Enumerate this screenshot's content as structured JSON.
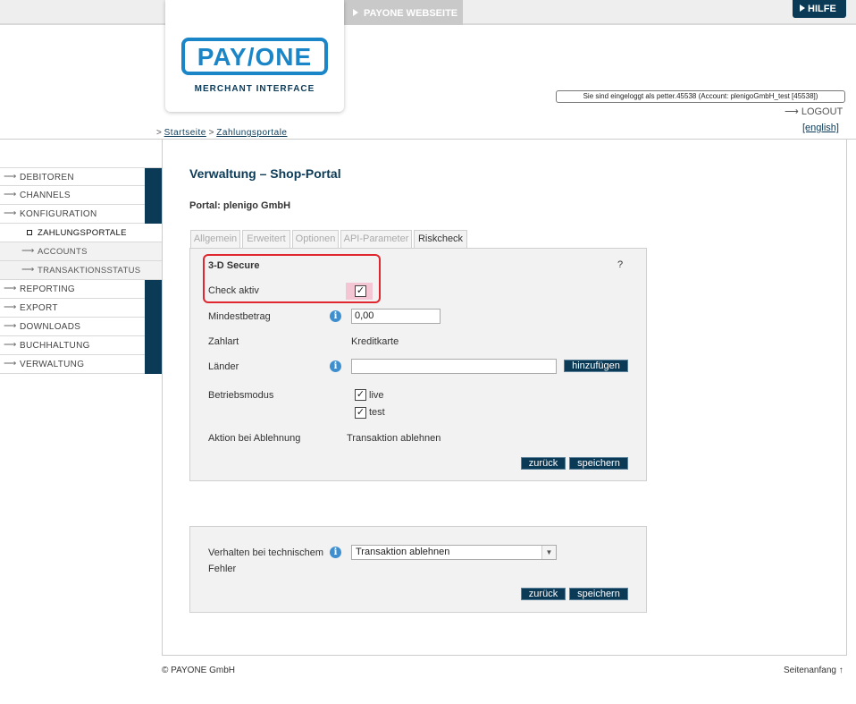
{
  "header": {
    "webseite_label": "PAYONE WEBSEITE",
    "hilfe_label": "HILFE",
    "logo_text": "PAY/ONE",
    "logo_subtitle": "MERCHANT INTERFACE",
    "login_info": "Sie sind eingeloggt als petter.45538 (Account: plenigoGmbH_test [45538])",
    "logout_label": "LOGOUT",
    "language_link": "[english]"
  },
  "breadcrumb": {
    "prefix": ">",
    "home": "Startseite",
    "separator": ">",
    "current": "Zahlungsportale"
  },
  "sidebar": {
    "items": [
      {
        "label": "DEBITOREN"
      },
      {
        "label": "CHANNELS"
      },
      {
        "label": "KONFIGURATION"
      },
      {
        "label": "ZAHLUNGSPORTALE"
      },
      {
        "label": "ACCOUNTS"
      },
      {
        "label": "TRANSAKTIONSSTATUS"
      },
      {
        "label": "REPORTING"
      },
      {
        "label": "EXPORT"
      },
      {
        "label": "DOWNLOADS"
      },
      {
        "label": "BUCHHALTUNG"
      },
      {
        "label": "VERWALTUNG"
      }
    ]
  },
  "main": {
    "title": "Verwaltung – Shop-Portal",
    "portal": "Portal: plenigo GmbH",
    "tabs": [
      {
        "label": "Allgemein"
      },
      {
        "label": "Erweitert"
      },
      {
        "label": "Optionen"
      },
      {
        "label": "API-Parameter"
      },
      {
        "label": "Riskcheck"
      }
    ],
    "section_title": "3-D Secure",
    "help_icon": "?",
    "check_aktiv_label": "Check aktiv",
    "check_aktiv_mark": "✓",
    "mindestbetrag_label": "Mindestbetrag",
    "mindestbetrag_value": "0,00",
    "zahlart_label": "Zahlart",
    "zahlart_value": "Kreditkarte",
    "laender_label": "Länder",
    "laender_value": "",
    "add_button": "hinzufügen",
    "betriebsmodus_label": "Betriebsmodus",
    "mode_live": "live",
    "mode_test": "test",
    "mode_live_mark": "✓",
    "mode_test_mark": "✓",
    "aktion_label": "Aktion bei Ablehnung",
    "aktion_value": "Transaktion ablehnen",
    "back_button": "zurück",
    "save_button": "speichern",
    "info_glyph": "i"
  },
  "panel2": {
    "verhalten_label_line1": "Verhalten bei technischem",
    "verhalten_label_line2": "Fehler",
    "select_value": "Transaktion ablehnen",
    "back_button": "zurück",
    "save_button": "speichern"
  },
  "footer": {
    "copyright": "© PAYONE GmbH",
    "top_link": "Seitenanfang ↑"
  },
  "colors": {
    "brand_dark": "#0b3a57",
    "brand_blue": "#1a86c8",
    "highlight_red": "#e0262e",
    "info_blue": "#3e8fd0"
  }
}
